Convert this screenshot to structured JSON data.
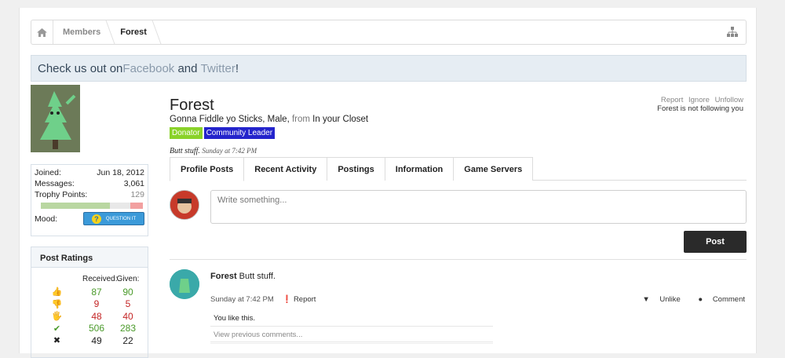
{
  "breadcrumb": {
    "members": "Members",
    "current": "Forest"
  },
  "notice": {
    "prefix": "Check us out on ",
    "facebook": "Facebook",
    "and": " and ",
    "twitter": "Twitter",
    "suffix": "!"
  },
  "sidebar": {
    "stats": [
      {
        "label": "Joined:",
        "value": "Jun 18, 2012"
      },
      {
        "label": "Messages:",
        "value": "3,061"
      },
      {
        "label": "Trophy Points:",
        "value": "129"
      }
    ],
    "mood_label": "Mood:",
    "mood_button": "QUESTION IT",
    "ratings_title": "Post Ratings",
    "ratings_headers": {
      "received": "Received:",
      "given": "Given:"
    },
    "ratings": [
      {
        "icon": "thumbs-up-icon",
        "glyph": "👍",
        "received": "87",
        "given": "90",
        "color": "green"
      },
      {
        "icon": "thumbs-down-icon",
        "glyph": "👎",
        "received": "9",
        "given": "5",
        "color": "red"
      },
      {
        "icon": "dislike-hand-icon",
        "glyph": "🖐",
        "received": "48",
        "given": "40",
        "color": "red"
      },
      {
        "icon": "checkmark-icon",
        "glyph": "✔",
        "received": "506",
        "given": "283",
        "color": "green"
      },
      {
        "icon": "cross-icon",
        "glyph": "✖",
        "received": "49",
        "given": "22",
        "color": "dark"
      }
    ]
  },
  "profile": {
    "name": "Forest",
    "subtitle_main": "Gonna Fiddle yo Sticks, Male,",
    "subtitle_from": " from ",
    "subtitle_location": "In your Closet",
    "badges": [
      "Donator",
      "Community Leader"
    ],
    "status": "Butt stuff.",
    "status_time": "Sunday at 7:42 PM"
  },
  "top_links": {
    "report": "Report",
    "ignore": "Ignore",
    "unfollow": "Unfollow",
    "follow_status": "Forest is not following you"
  },
  "tabs": [
    "Profile Posts",
    "Recent Activity",
    "Postings",
    "Information",
    "Game Servers"
  ],
  "compose": {
    "placeholder": "Write something...",
    "post_button": "Post"
  },
  "message": {
    "author": "Forest",
    "text": " Butt stuff.",
    "time": "Sunday at 7:42 PM",
    "report": "Report",
    "unlike": "Unlike",
    "comment": "Comment",
    "likes": "You like this.",
    "view_previous": "View previous comments..."
  },
  "colors": {
    "green": "#4a9a2a",
    "red": "#c42525",
    "donator": "#8ad22a",
    "leader": "#2424cc"
  }
}
